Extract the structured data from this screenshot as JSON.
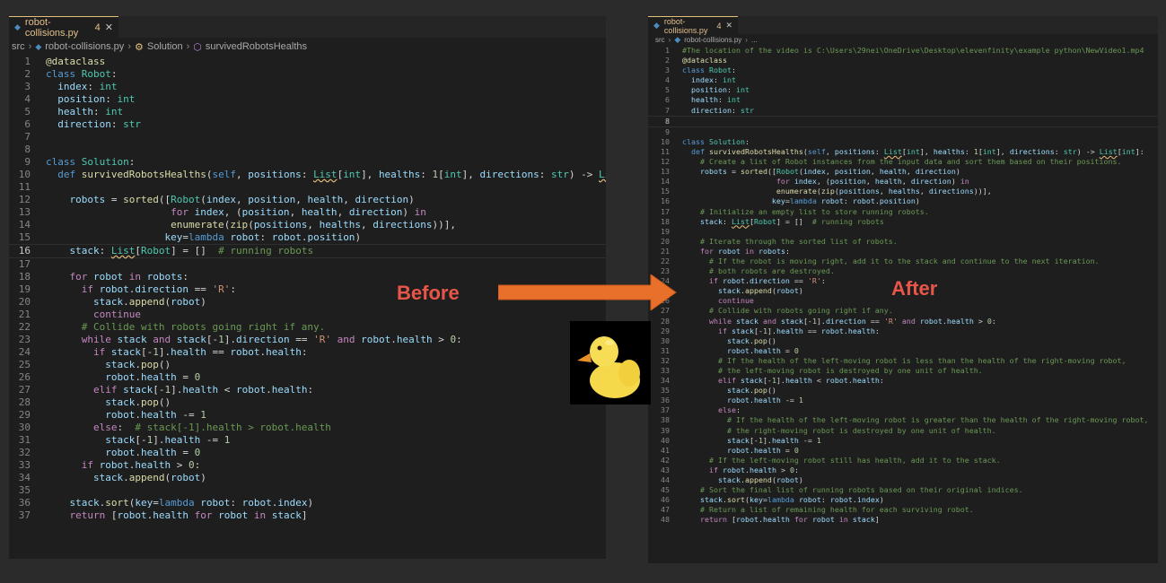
{
  "before": {
    "label": "Before",
    "tab": {
      "filename": "robot-collisions.py",
      "badge": "4"
    },
    "breadcrumb": [
      "src",
      "robot-collisions.py",
      "Solution",
      "survivedRobotsHealths"
    ],
    "current_line": 16,
    "lines": [
      {
        "n": "1",
        "t": "@dataclass"
      },
      {
        "n": "2",
        "t": "class Robot:"
      },
      {
        "n": "3",
        "t": "  index: int"
      },
      {
        "n": "4",
        "t": "  position: int"
      },
      {
        "n": "5",
        "t": "  health: int"
      },
      {
        "n": "6",
        "t": "  direction: str"
      },
      {
        "n": "7",
        "t": ""
      },
      {
        "n": "8",
        "t": ""
      },
      {
        "n": "9",
        "t": "class Solution:"
      },
      {
        "n": "10",
        "t": "  def survivedRobotsHealths(self, positions: List[int], healths: 1[int], directions: str) -> List[int]:"
      },
      {
        "n": "11",
        "t": ""
      },
      {
        "n": "12",
        "t": "    robots = sorted([Robot(index, position, health, direction)"
      },
      {
        "n": "13",
        "t": "                     for index, (position, health, direction) in"
      },
      {
        "n": "14",
        "t": "                     enumerate(zip(positions, healths, directions))],"
      },
      {
        "n": "15",
        "t": "                    key=lambda robot: robot.position)"
      },
      {
        "n": "16",
        "t": "    stack: List[Robot] = []  # running robots"
      },
      {
        "n": "17",
        "t": ""
      },
      {
        "n": "18",
        "t": "    for robot in robots:"
      },
      {
        "n": "19",
        "t": "      if robot.direction == 'R':"
      },
      {
        "n": "20",
        "t": "        stack.append(robot)"
      },
      {
        "n": "21",
        "t": "        continue"
      },
      {
        "n": "22",
        "t": "      # Collide with robots going right if any."
      },
      {
        "n": "23",
        "t": "      while stack and stack[-1].direction == 'R' and robot.health > 0:"
      },
      {
        "n": "24",
        "t": "        if stack[-1].health == robot.health:"
      },
      {
        "n": "25",
        "t": "          stack.pop()"
      },
      {
        "n": "26",
        "t": "          robot.health = 0"
      },
      {
        "n": "27",
        "t": "        elif stack[-1].health < robot.health:"
      },
      {
        "n": "28",
        "t": "          stack.pop()"
      },
      {
        "n": "29",
        "t": "          robot.health -= 1"
      },
      {
        "n": "30",
        "t": "        else:  # stack[-1].health > robot.health"
      },
      {
        "n": "31",
        "t": "          stack[-1].health -= 1"
      },
      {
        "n": "32",
        "t": "          robot.health = 0"
      },
      {
        "n": "33",
        "t": "      if robot.health > 0:"
      },
      {
        "n": "34",
        "t": "        stack.append(robot)"
      },
      {
        "n": "35",
        "t": ""
      },
      {
        "n": "36",
        "t": "    stack.sort(key=lambda robot: robot.index)"
      },
      {
        "n": "37",
        "t": "    return [robot.health for robot in stack]"
      }
    ]
  },
  "after": {
    "label": "After",
    "tab": {
      "filename": "robot-collisions.py",
      "badge": "4"
    },
    "breadcrumb": [
      "src",
      "robot-collisions.py",
      "..."
    ],
    "current_line": 8,
    "lines": [
      {
        "n": "1",
        "t": "#The location of the video is C:\\Users\\29nei\\OneDrive\\Desktop\\elevenfinity\\example python\\NewVideo1.mp4"
      },
      {
        "n": "2",
        "t": "@dataclass"
      },
      {
        "n": "3",
        "t": "class Robot:"
      },
      {
        "n": "4",
        "t": "  index: int"
      },
      {
        "n": "5",
        "t": "  position: int"
      },
      {
        "n": "6",
        "t": "  health: int"
      },
      {
        "n": "7",
        "t": "  direction: str"
      },
      {
        "n": "8",
        "t": "  "
      },
      {
        "n": "9",
        "t": ""
      },
      {
        "n": "10",
        "t": "class Solution:"
      },
      {
        "n": "11",
        "t": "  def survivedRobotsHealths(self, positions: List[int], healths: 1[int], directions: str) -> List[int]:"
      },
      {
        "n": "12",
        "t": "    # Create a list of Robot instances from the input data and sort them based on their positions."
      },
      {
        "n": "13",
        "t": "    robots = sorted([Robot(index, position, health, direction)"
      },
      {
        "n": "14",
        "t": "                     for index, (position, health, direction) in"
      },
      {
        "n": "15",
        "t": "                     enumerate(zip(positions, healths, directions))],"
      },
      {
        "n": "16",
        "t": "                    key=lambda robot: robot.position)"
      },
      {
        "n": "17",
        "t": "    # Initialize an empty list to store running robots."
      },
      {
        "n": "18",
        "t": "    stack: List[Robot] = []  # running robots"
      },
      {
        "n": "19",
        "t": ""
      },
      {
        "n": "20",
        "t": "    # Iterate through the sorted list of robots."
      },
      {
        "n": "21",
        "t": "    for robot in robots:"
      },
      {
        "n": "22",
        "t": "      # If the robot is moving right, add it to the stack and continue to the next iteration."
      },
      {
        "n": "23",
        "t": "      # both robots are destroyed."
      },
      {
        "n": "24",
        "t": "      if robot.direction == 'R':"
      },
      {
        "n": "25",
        "t": "        stack.append(robot)"
      },
      {
        "n": "26",
        "t": "        continue"
      },
      {
        "n": "27",
        "t": "      # Collide with robots going right if any."
      },
      {
        "n": "28",
        "t": "      while stack and stack[-1].direction == 'R' and robot.health > 0:"
      },
      {
        "n": "29",
        "t": "        if stack[-1].health == robot.health:"
      },
      {
        "n": "30",
        "t": "          stack.pop()"
      },
      {
        "n": "31",
        "t": "          robot.health = 0"
      },
      {
        "n": "32",
        "t": "        # If the health of the left-moving robot is less than the health of the right-moving robot,"
      },
      {
        "n": "33",
        "t": "        # the left-moving robot is destroyed by one unit of health."
      },
      {
        "n": "34",
        "t": "        elif stack[-1].health < robot.health:"
      },
      {
        "n": "35",
        "t": "          stack.pop()"
      },
      {
        "n": "36",
        "t": "          robot.health -= 1"
      },
      {
        "n": "37",
        "t": "        else:"
      },
      {
        "n": "38",
        "t": "          # If the health of the left-moving robot is greater than the health of the right-moving robot,"
      },
      {
        "n": "39",
        "t": "          # the right-moving robot is destroyed by one unit of health."
      },
      {
        "n": "40",
        "t": "          stack[-1].health -= 1"
      },
      {
        "n": "41",
        "t": "          robot.health = 0"
      },
      {
        "n": "42",
        "t": "      # If the left-moving robot still has health, add it to the stack."
      },
      {
        "n": "43",
        "t": "      if robot.health > 0:"
      },
      {
        "n": "44",
        "t": "        stack.append(robot)"
      },
      {
        "n": "45",
        "t": "    # Sort the final list of running robots based on their original indices."
      },
      {
        "n": "46",
        "t": "    stack.sort(key=lambda robot: robot.index)"
      },
      {
        "n": "47",
        "t": "    # Return a list of remaining health for each surviving robot."
      },
      {
        "n": "48",
        "t": "    return [robot.health for robot in stack]"
      }
    ]
  },
  "colors": {
    "arrow": "#e8702a",
    "label": "#e8564a",
    "duck": "#f5d94a"
  },
  "icons": {
    "tab_file": "python-file-icon",
    "tab_close": "close-icon",
    "duck": "rubber-duck-icon",
    "arrow": "right-arrow-icon"
  }
}
